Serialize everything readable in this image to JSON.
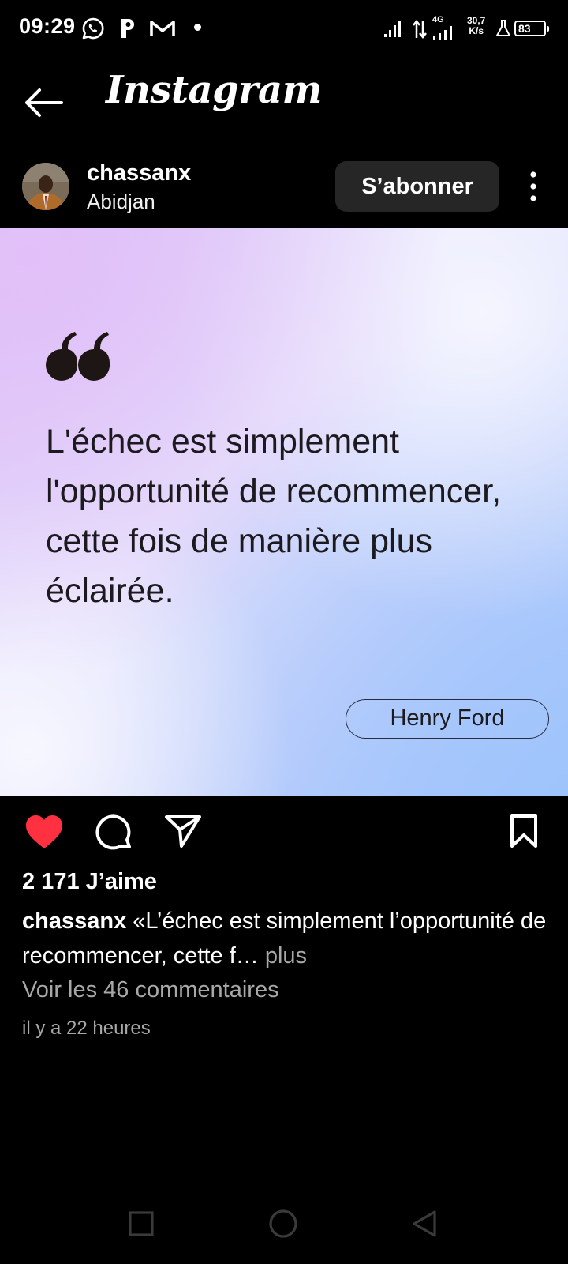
{
  "status_bar": {
    "time": "09:29",
    "network_type": "4G",
    "speed_value": "30,7",
    "speed_unit": "K/s",
    "battery_level": "83",
    "icons": [
      "whatsapp-icon",
      "p-app-icon",
      "gmail-icon",
      "notification-dot",
      "signal-icon",
      "data-arrows-icon",
      "signal-4g-icon",
      "lab-icon",
      "battery-icon"
    ]
  },
  "header": {
    "app_title": "Instagram",
    "back_icon": "arrow-left-icon"
  },
  "post": {
    "username": "chassanx",
    "location": "Abidjan",
    "follow_label": "S’abonner",
    "more_icon": "vertical-dots-icon",
    "image": {
      "quote_text": "L'échec est simplement l'opportunité de recommencer, cette fois de manière plus éclairée.",
      "author": "Henry Ford",
      "gradient_colors": [
        "#e2bff8",
        "#f4f5ff",
        "#a5c6fc"
      ]
    },
    "actions": {
      "like_icon": "heart-filled-icon",
      "like_color": "#ff3040",
      "comment_icon": "comment-icon",
      "share_icon": "send-icon",
      "save_icon": "bookmark-icon"
    },
    "likes_text": "2 171 J’aime",
    "caption_user": "chassanx",
    "caption_text": "«L’échec est simplement l’opportunité de recommencer, cette f…",
    "caption_more": "plus",
    "comments_link": "Voir les 46 commentaires",
    "timestamp": "il y a 22 heures"
  },
  "nav_bar": {
    "icons": [
      "recent-apps-icon",
      "home-icon",
      "back-triangle-icon"
    ]
  }
}
